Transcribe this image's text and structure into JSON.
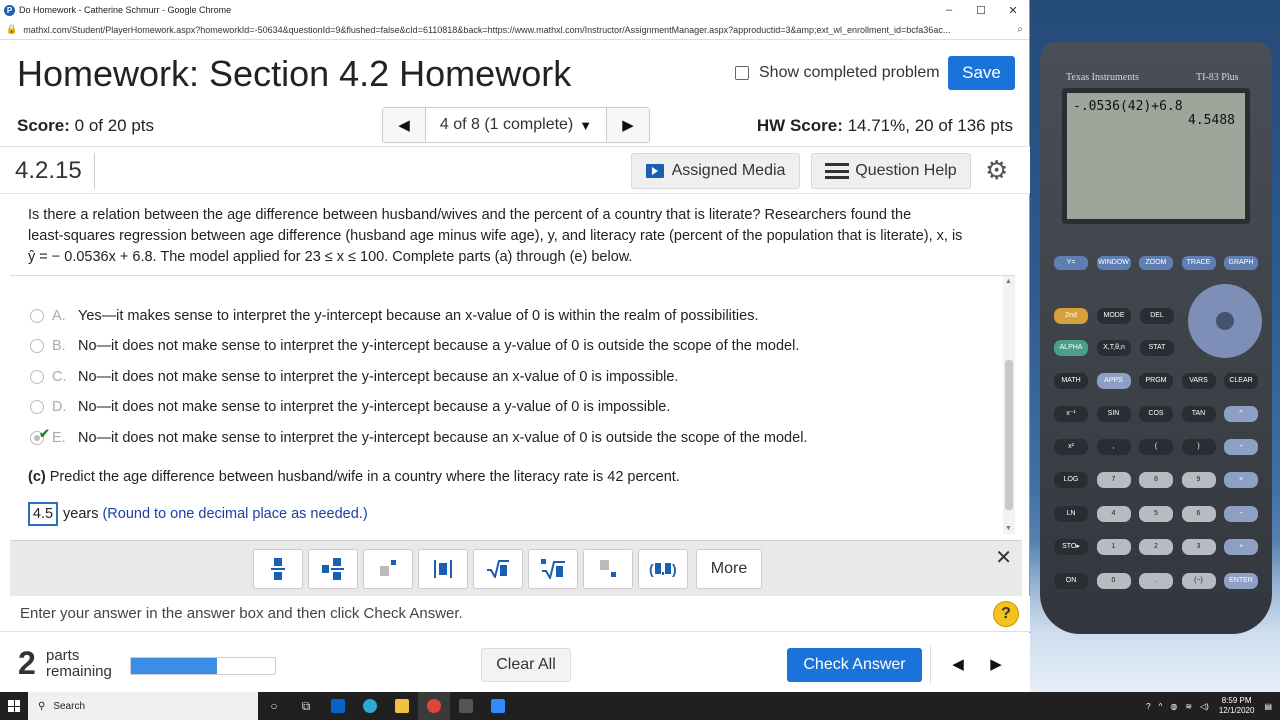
{
  "browser": {
    "window_title": "Do Homework - Catherine Schmurr - Google Chrome",
    "url": "mathxl.com/Student/PlayerHomework.aspx?homeworkId=-50634&questionId=9&flushed=false&cId=6110818&back=https://www.mathxl.com/Instructor/AssignmentManager.aspx?approductid=3&amp;ext_wl_enrollment_id=bcfa36ac...",
    "controls": [
      "–",
      "☐",
      "✕"
    ]
  },
  "homework": {
    "title": "Homework: Section 4.2 Homework",
    "show_completed_label": "Show completed problem",
    "save_label": "Save"
  },
  "score_row": {
    "score_label": "Score:",
    "score_value": " 0 of 20 pts",
    "nav_position": "4 of 8 (1 complete)",
    "hw_score_label": "HW Score:",
    "hw_score_value": " 14.71%, 20 of 136 pts"
  },
  "question_bar": {
    "question_id": "4.2.15",
    "assigned_media_label": "Assigned Media",
    "question_help_label": "Question Help"
  },
  "question": {
    "text_line1": "Is there a relation between the age difference between husband/wives and the percent of a country that is literate? Researchers found the",
    "text_line2": "least-squares regression between age difference (husband age minus wife age), y, and literacy rate (percent of the population that is literate), x, is",
    "text_line3": "ŷ = − 0.0536x + 6.8. The model applied for 23 ≤ x ≤ 100. Complete parts (a) through (e) below."
  },
  "options": [
    {
      "letter": "A.",
      "text": "Yes—it makes sense to interpret the y-intercept because an x-value of 0 is within the realm of possibilities.",
      "selected": false
    },
    {
      "letter": "B.",
      "text": "No—it does not make sense to interpret the y-intercept because a y-value of 0 is outside the scope of the model.",
      "selected": false
    },
    {
      "letter": "C.",
      "text": "No—it does not make sense to interpret the y-intercept because an x-value of 0 is impossible.",
      "selected": false
    },
    {
      "letter": "D.",
      "text": "No—it does not make sense to interpret the y-intercept because a y-value of 0 is impossible.",
      "selected": false
    },
    {
      "letter": "E.",
      "text": "No—it does not make sense to interpret the y-intercept because an x-value of 0 is outside the scope of the model.",
      "selected": true
    }
  ],
  "part_c": {
    "label": "(c)",
    "text": " Predict the age difference between husband/wife in a country where the literacy rate is 42 percent.",
    "answer_value": "4.5",
    "units": "years",
    "hint": "(Round to one decimal place as needed.)"
  },
  "toolbar": {
    "tools": [
      "fraction",
      "mixed-number",
      "exponent",
      "absolute-value",
      "square-root",
      "nth-root",
      "subscript",
      "ordered-pair"
    ],
    "more_label": "More",
    "close_label": "✕"
  },
  "instructions": {
    "text": "Enter your answer in the answer box and then click Check Answer.",
    "help_label": "?"
  },
  "footer": {
    "parts_count": "2",
    "parts_label_line1": "parts",
    "parts_label_line2": "remaining",
    "progress_fraction": 0.6,
    "clear_all_label": "Clear All",
    "check_answer_label": "Check Answer"
  },
  "calculator": {
    "brand": "Texas Instruments",
    "model": "TI-83 Plus",
    "expression": "-.0536(42)+6.8",
    "result": "4.5488",
    "top_keys": [
      "Y=",
      "WINDOW",
      "ZOOM",
      "TRACE",
      "GRAPH"
    ],
    "rows": [
      [
        "2nd",
        "MODE",
        "DEL"
      ],
      [
        "ALPHA",
        "X,T,θ,n",
        "STAT"
      ],
      [
        "MATH",
        "APPS",
        "PRGM",
        "VARS",
        "CLEAR"
      ],
      [
        "x⁻¹",
        "SIN",
        "COS",
        "TAN",
        "^"
      ],
      [
        "x²",
        ",",
        "(",
        ")",
        "÷"
      ],
      [
        "LOG",
        "7",
        "8",
        "9",
        "×"
      ],
      [
        "LN",
        "4",
        "5",
        "6",
        "−"
      ],
      [
        "STO▸",
        "1",
        "2",
        "3",
        "+"
      ],
      [
        "ON",
        "0",
        ".",
        "(−)",
        "ENTER"
      ]
    ]
  },
  "taskbar": {
    "search_placeholder": "Search",
    "time": "8:59 PM",
    "date": "12/1/2020"
  },
  "colors": {
    "primary_button": "#1a73d9",
    "hint_text": "#1a3fa8",
    "help_icon": "#f4c21c",
    "check_mark": "#1e8a2c"
  }
}
